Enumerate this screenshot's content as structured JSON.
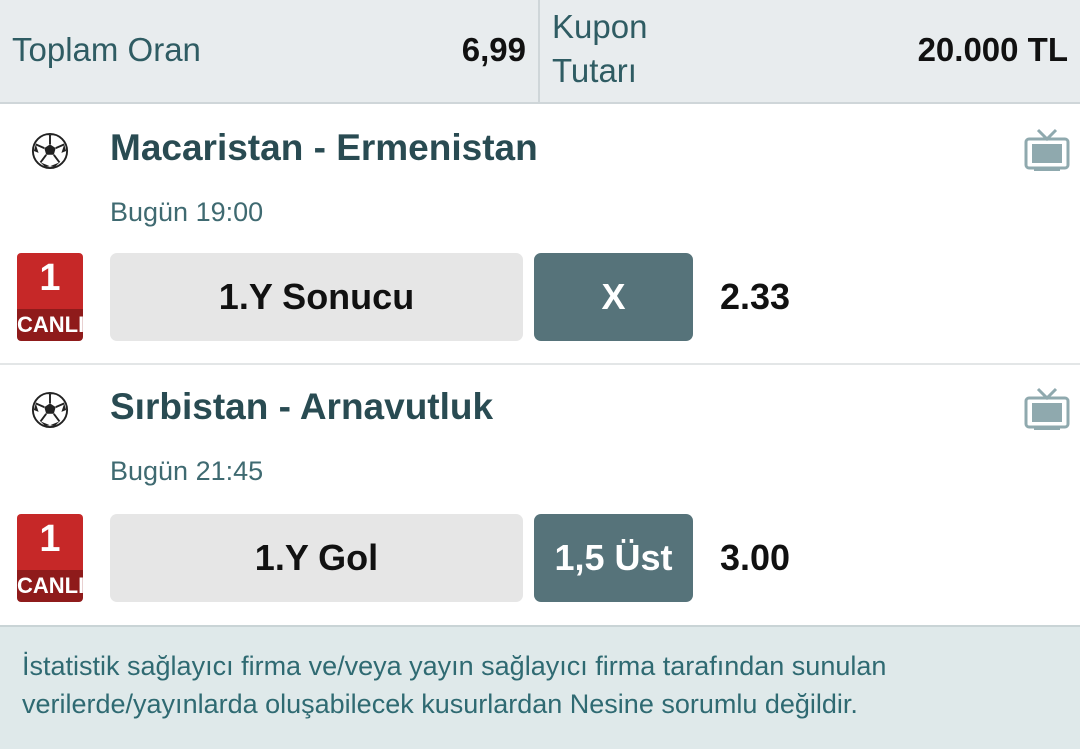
{
  "summary": {
    "total_odds_label": "Toplam Oran",
    "total_odds_value": "6,99",
    "coupon_amount_label": "Kupon Tutarı",
    "coupon_amount_value": "20.000 TL"
  },
  "matches": [
    {
      "sport_icon": "soccer-ball-icon",
      "title": "Macaristan - Ermenistan",
      "time": "Bugün 19:00",
      "tv_icon": "tv-icon",
      "live_number": "1",
      "live_label": "CANLI",
      "market": "1.Y Sonucu",
      "pick": "X",
      "odd": "2.33"
    },
    {
      "sport_icon": "soccer-ball-icon",
      "title": "Sırbistan - Arnavutluk",
      "time": "Bugün 21:45",
      "tv_icon": "tv-icon",
      "live_number": "1",
      "live_label": "CANLI",
      "market": "1.Y Gol",
      "pick": "1,5 Üst",
      "odd": "3.00"
    }
  ],
  "notice": "İstatistik sağlayıcı firma ve/veya yayın sağlayıcı firma tarafından sunulan verilerde/yayınlarda oluşabilecek kusurlardan Nesine sorumlu değildir.",
  "colors": {
    "live_badge": "#c62828",
    "pick_button": "#56737a",
    "market_button": "#e6e6e6",
    "title_text": "#294b52"
  }
}
